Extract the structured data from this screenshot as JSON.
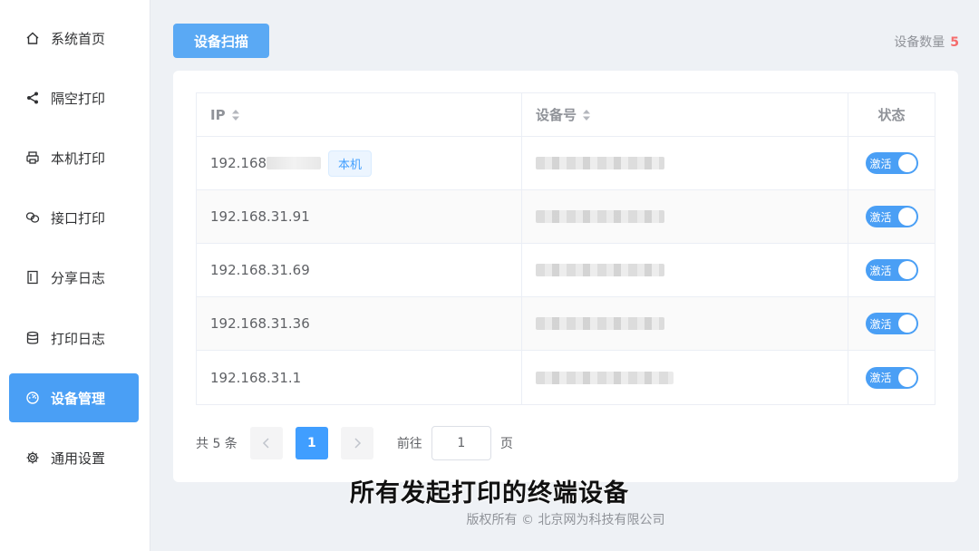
{
  "sidebar": {
    "items": [
      {
        "label": "系统首页",
        "icon": "home-icon",
        "active": false
      },
      {
        "label": "隔空打印",
        "icon": "share-icon",
        "active": false
      },
      {
        "label": "本机打印",
        "icon": "printer-icon",
        "active": false
      },
      {
        "label": "接口打印",
        "icon": "link-icon",
        "active": false
      },
      {
        "label": "分享日志",
        "icon": "document-icon",
        "active": false
      },
      {
        "label": "打印日志",
        "icon": "database-icon",
        "active": false
      },
      {
        "label": "设备管理",
        "icon": "dashboard-icon",
        "active": true
      },
      {
        "label": "通用设置",
        "icon": "gear-icon",
        "active": false
      }
    ]
  },
  "toolbar": {
    "scan_label": "设备扫描",
    "count_label": "设备数量",
    "count_value": "5"
  },
  "table": {
    "headers": {
      "ip": "IP",
      "device": "设备号",
      "status": "状态"
    },
    "rows": [
      {
        "ip": "192.168",
        "tag": "本机",
        "status": "激活",
        "active": true
      },
      {
        "ip": "192.168.31.91",
        "tag": "",
        "status": "激活",
        "active": true
      },
      {
        "ip": "192.168.31.69",
        "tag": "",
        "status": "激活",
        "active": true
      },
      {
        "ip": "192.168.31.36",
        "tag": "",
        "status": "激活",
        "active": true
      },
      {
        "ip": "192.168.31.1",
        "tag": "",
        "status": "激活",
        "active": true
      }
    ]
  },
  "pagination": {
    "total_text": "共 5 条",
    "current_page": "1",
    "goto_label": "前往",
    "goto_value": "1",
    "page_suffix": "页"
  },
  "subtitle": "所有发起打印的终端设备",
  "footer": "版权所有 © 北京网为科技有限公司",
  "colors": {
    "accent": "#409eff",
    "active_menu": "#4a9ff5",
    "count_highlight": "#f56c6c"
  }
}
